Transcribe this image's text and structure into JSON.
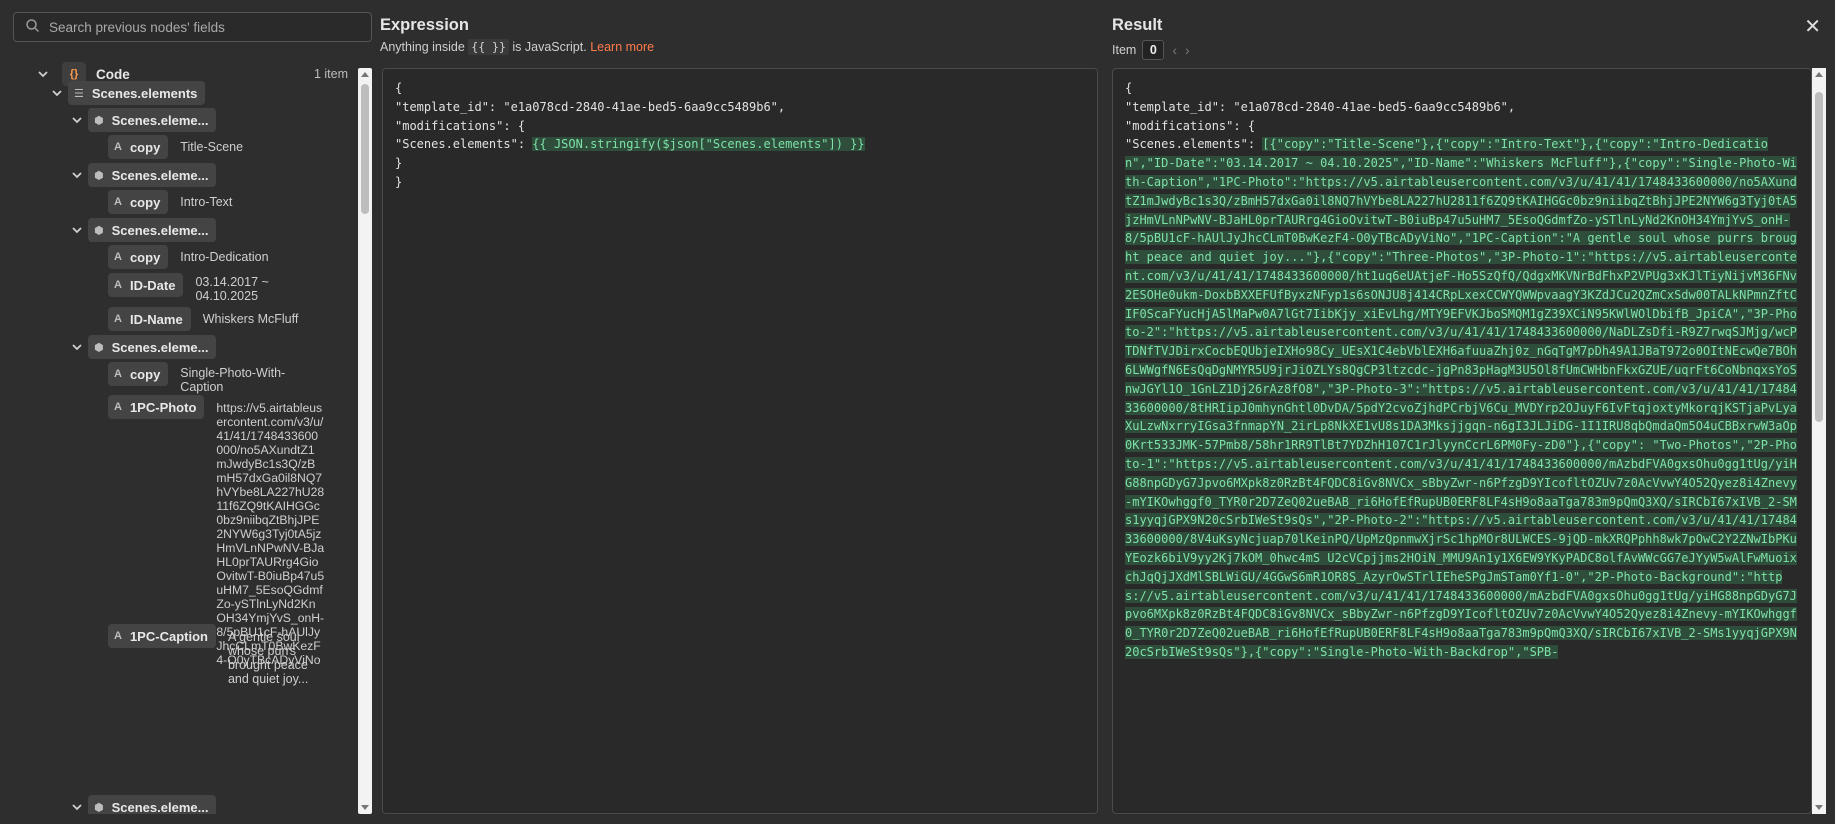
{
  "search": {
    "placeholder": "Search previous nodes' fields"
  },
  "tree": {
    "code_label": "Code",
    "code_count": "1 item",
    "scenes_label": "Scenes.elements",
    "element_label": "Scenes.eleme...",
    "fields": [
      {
        "key": "copy",
        "value": "Title-Scene"
      },
      {
        "key": "copy",
        "value": "Intro-Text"
      },
      {
        "key": "copy",
        "value": "Intro-Dedication"
      },
      {
        "key": "ID-Date",
        "value": "03.14.2017 ~ 04.10.2025"
      },
      {
        "key": "ID-Name",
        "value": "Whiskers McFluff"
      },
      {
        "key": "copy",
        "value": "Single-Photo-With-Caption"
      },
      {
        "key": "1PC-Photo",
        "value": "https://v5.airtableusercontent.com/v3/u/41/41/1748433600000/no5AXundtZ1mJwdyBc1s3Q/zBmH57dxGa0il8NQ7hVYbe8LA227hU2811f6ZQ9tKAIHGGc0bz9niibqZtBhjJPE2NYW6g3Tyj0tA5jzHmVLnNPwNV-BJaHL0prTAURrg4GioOvitwT-B0iuBp47u5uHM7_5EsoQGdmfZo-ySTlnLyNd2KnOH34YmjYvS_onH-8/5pBU1cF-hAUlJyJhcCLmT0BwKezF4-O0yTBcADyViNo"
      },
      {
        "key": "1PC-Caption",
        "value": "A gentle soul whose purrs brought peace and quiet joy..."
      }
    ]
  },
  "expression": {
    "title": "Expression",
    "hint_prefix": "Anything inside",
    "hint_code": "{{ }}",
    "hint_suffix": "is JavaScript.",
    "hint_link": "Learn more",
    "lines": [
      "{",
      "\"template_id\": \"e1a078cd-2840-41ae-bed5-6aa9cc5489b6\",",
      "\"modifications\": {",
      "\"Scenes.elements\": ",
      "}",
      "}"
    ],
    "highlight": "{{ JSON.stringify($json[\"Scenes.elements\"]) }}"
  },
  "result": {
    "title": "Result",
    "item_label": "Item",
    "item_index": "0",
    "lines": [
      "{",
      "\"template_id\": \"e1a078cd-2840-41ae-bed5-6aa9cc5489b6\",",
      "\"modifications\": {",
      "\"Scenes.elements\": "
    ],
    "value": "[{\"copy\":\"Title-Scene\"},{\"copy\":\"Intro-Text\"},{\"copy\":\"Intro-Dedication\",\"ID-Date\":\"03.14.2017 ~ 04.10.2025\",\"ID-Name\":\"Whiskers McFluff\"},{\"copy\":\"Single-Photo-With-Caption\",\"1PC-Photo\":\"https://v5.airtableusercontent.com/v3/u/41/41/1748433600000/no5AXundtZ1mJwdyBc1s3Q/zBmH57dxGa0il8NQ7hVYbe8LA227hU2811f6ZQ9tKAIHGGc0bz9niibqZtBhjJPE2NYW6g3Tyj0tA5jzHmVLnNPwNV-BJaHL0prTAURrg4GioOvitwT-B0iuBp47u5uHM7_5EsoQGdmfZo-ySTlnLyNd2KnOH34YmjYvS_onH-8/5pBU1cF-hAUlJyJhcCLmT0BwKezF4-O0yTBcADyViNo\",\"1PC-Caption\":\"A gentle  soul whose purrs brought peace and quiet joy...\"},{\"copy\":\"Three-Photos\",\"3P-Photo-1\":\"https://v5.airtableusercontent.com/v3/u/41/41/1748433600000/ht1uq6eUAtjeF-Ho5SzQfQ/QdgxMKVNrBdFhxP2VPUg3xKJlTiyNijvM36FNv2ESOHe0ukm-DoxbBXXEFUfByxzNFyp1s6sONJU8j414CRpLxexCCWYQWWpvaagY3KZdJCu2QZmCxSdw00TALkNPmnZftCIF0ScaFYucHjA5lMaPw0A7lGt7IibKjy_xiEvLhg/MTY9EFVKJboSMQM1gZ39XCiN95KWlWOlDbifB_JpiCA\",\"3P-Photo-2\":\"https://v5.airtableusercontent.com/v3/u/41/41/1748433600000/NaDLZsDfi-R9Z7rwqSJMjg/wcPTDNfTVJDirxCocbEQUbjeIXHo98Cy_UEsX1C4ebVblEXH6afuuaZhj0z_nGqTgM7pDh49A1JBaT972o0OItNEcwQe7BOh6LWWgfN6EsQqDgNMYR5U9jrJiOZLYs8QgCP3ltzcdc-jgPn83pHagM3U5Ol8fUmCWHbnFkxGZUE/uqrFt6CoNbnqxsYoSnwJGYl1O_1GnLZ1Dj26rAz8fO8\",\"3P-Photo-3\":\"https://v5.airtableusercontent.com/v3/u/41/41/1748433600000/8tHRIipJ0mhynGhtl0DvDA/5pdY2cvoZjhdPCrbjV6Cu_MVDYrp2OJuyF6IvFtqjoxtyMkorqjKSTjaPvLyaXuLzwNxrryIGsa3fnmapYN_2irLp8NkXE1vU8s1DA3Mksjjgqn-n6gI3JLJiDG-1I1IRU8qbQmdaQm5O4uCBBxrwW3aOp0Krt533JMK-57Pmb8/58hr1RR9TlBt7YDZhH107C1rJlyynCcrL6PM0Fy-zD0\"},{\"copy\": \"Two-Photos\",\"2P-Photo-1\":\"https://v5.airtableusercontent.com/v3/u/41/41/1748433600000/mAzbdFVA0gxsOhu0gg1tUg/yiHG88npGDyG7Jpvo6MXpk8z0RzBt4FQDC8iGv8NVCx_sBbyZwr-n6PfzgD9YIcofltOZUv7z0AcVvwY4O52Qyez8i4Znevy-mYIKOwhggf0_TYR0r2D7ZeQ02ueBAB_ri6HofEfRupUB0ERF8LF4sH9o8aaTga783m9pQmQ3XQ/sIRCbI67xIVB_2-SMs1yyqjGPX9N20cSrbIWeSt9sQs\",\"2P-Photo-2\":\"https://v5.airtableusercontent.com/v3/u/41/41/1748433600000/8V4uKsyNcjuap70lKeinPQ/UpMzQpnmwXjrSc1hpMOr8ULWCES-9jQD-mkXRQPphh8wk7pOwC2Y2ZNwIbPKuYEozk6biV9yy2Kj7kOM_0hwc4mS U2cVCpjjms2HOiN_MMU9An1y1X6EW9YKyPADC8olfAvWWcGG7eJYyW5wAlFwMuoixchJqQjJXdMlSBLWiGU/4GGwS6mR1OR8S_AzyrOwSTrlIEheSPgJmSTam0Yf1-0\",\"2P-Photo-Background\":\"https://v5.airtableusercontent.com/v3/u/41/41/1748433600000/mAzbdFVA0gxsOhu0gg1tUg/yiHG88npGDyG7Jpvo6MXpk8z0RzBt4FQDC8iGv8NVCx_sBbyZwr-n6PfzgD9YIcofltOZUv7z0AcVvwY4O52Qyez8i4Znevy-mYIKOwhggf0_TYR0r2D7ZeQ02ueBAB_ri6HofEfRupUB0ERF8LF4sH9o8aaTga783m9pQmQ3XQ/sIRCbI67xIVB_2-SMs1yyqjGPX9N20cSrbIWeSt9sQs\"},{\"copy\":\"Single-Photo-With-Backdrop\",\"SPB-"
  }
}
